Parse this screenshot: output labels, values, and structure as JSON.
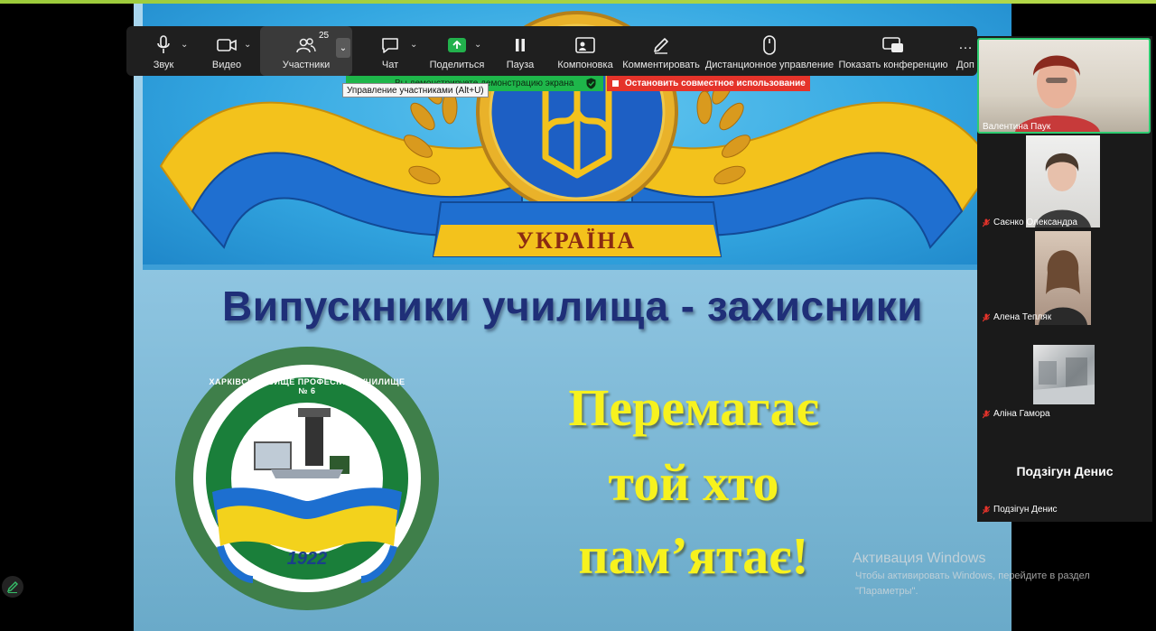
{
  "toolbar": {
    "audio_label": "Звук",
    "video_label": "Видео",
    "participants_label": "Участники",
    "participants_count": "25",
    "chat_label": "Чат",
    "share_label": "Поделиться",
    "pause_label": "Пауза",
    "layout_label": "Компоновка",
    "annotate_label": "Комментировать",
    "remote_label": "Дистанционное управление",
    "show_conf_label": "Показать конференцию",
    "more_label": "Доп"
  },
  "share_status": {
    "text": "Вы демонстрируете демонстрацию экрана",
    "stop_label": "Остановить совместное использование"
  },
  "tooltip": "Управление участниками (Alt+U)",
  "slide": {
    "banner_text": "УКРАЇНА",
    "title": "Випускники училища - захисники",
    "motto_line1": "Перемагає",
    "motto_line2": "той хто",
    "motto_line3": "пам’ятає!",
    "emblem_arc": "ХАРКІВСЬКЕ ВИЩЕ ПРОФЕСІЙНЕ УЧИЛИЩЕ № 6",
    "emblem_year": "1922"
  },
  "participants": [
    {
      "name": "Валентина Паук",
      "muted": false,
      "speaking": true
    },
    {
      "name": "Саєнко Олександра",
      "muted": true
    },
    {
      "name": "Алена Тепляк",
      "muted": true
    },
    {
      "name": "Аліна Гамора",
      "muted": true
    },
    {
      "name": "Подзігун Денис",
      "muted": true,
      "display_name": "Подзігун Денис"
    }
  ],
  "windows_activation": {
    "title": "Активация Windows",
    "line1": "Чтобы активировать Windows, перейдите в раздел",
    "line2": "\"Параметры\"."
  },
  "colors": {
    "accent_green": "#22b14c",
    "stop_red": "#e5332a",
    "speaking_border": "#2ecc71",
    "title_blue": "#1f2f78",
    "motto_yellow": "#f7f21e"
  }
}
